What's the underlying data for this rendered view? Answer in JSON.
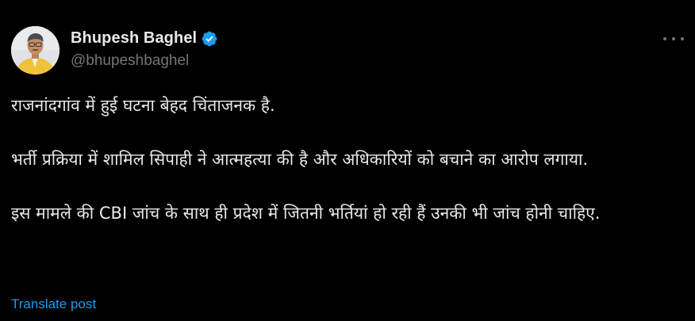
{
  "author": {
    "display_name": "Bhupesh Baghel",
    "handle": "@bhupeshbaghel",
    "verified": true,
    "avatar_icon": "profile-photo"
  },
  "tweet": {
    "paragraphs": [
      "राजनांदगांव में हुई घटना बेहद चिंताजनक है.",
      "भर्ती प्रक्रिया में शामिल सिपाही ने आत्महत्या की है और अधिकारियों को बचाने का आरोप लगाया.",
      "इस मामले की CBI जांच के साथ ही प्रदेश में जितनी भर्तियां हो रही हैं उनकी भी जांच होनी चाहिए."
    ],
    "translate_label": "Translate post"
  },
  "icons": {
    "verified": "verified-badge-icon",
    "more": "more-options-icon"
  },
  "colors": {
    "background": "#000000",
    "text": "#e7e9ea",
    "secondary": "#71767b",
    "accent": "#1d9bf0"
  }
}
